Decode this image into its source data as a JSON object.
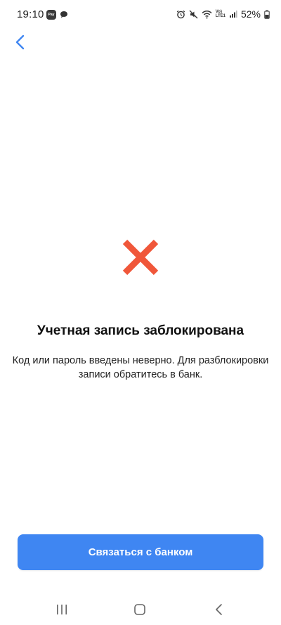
{
  "status_bar": {
    "time": "19:10",
    "battery": "52%",
    "pay_label": "Pay",
    "network_label_top": "Vo)",
    "network_label_bottom": "LTE1"
  },
  "header": {
    "back_icon": "chevron-left-icon"
  },
  "main": {
    "status_icon": "cross-icon",
    "title": "Учетная запись заблокирована",
    "message": "Код или пароль введены неверно. Для разблокировки записи обратитесь в банк."
  },
  "actions": {
    "contact_label": "Связаться с банком"
  },
  "nav": {
    "recents_icon": "recents-icon",
    "home_icon": "home-icon",
    "back_icon": "back-icon"
  },
  "colors": {
    "accent": "#3f86f2",
    "error": "#f0573a",
    "back_chevron": "#3f86f2"
  }
}
